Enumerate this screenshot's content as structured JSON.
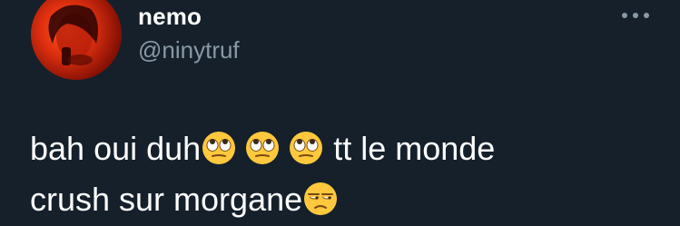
{
  "tweet": {
    "author": {
      "display_name": "nemo",
      "handle": "@ninytruf",
      "avatar_icon": "profile-photo"
    },
    "more_icon": "more-dots-icon",
    "text": {
      "line1_part1": "bah oui duh",
      "line1_emojis": [
        "face-with-rolling-eyes",
        "face-with-rolling-eyes",
        "face-with-rolling-eyes"
      ],
      "line1_part2": " tt le monde",
      "line2_part1": "crush sur morgane",
      "line2_emoji": "unamused-face"
    }
  },
  "colors": {
    "background": "#15202b",
    "primary_text": "#ffffff",
    "secondary_text": "#8899a6",
    "emoji_yellow": "#ffc83d"
  }
}
